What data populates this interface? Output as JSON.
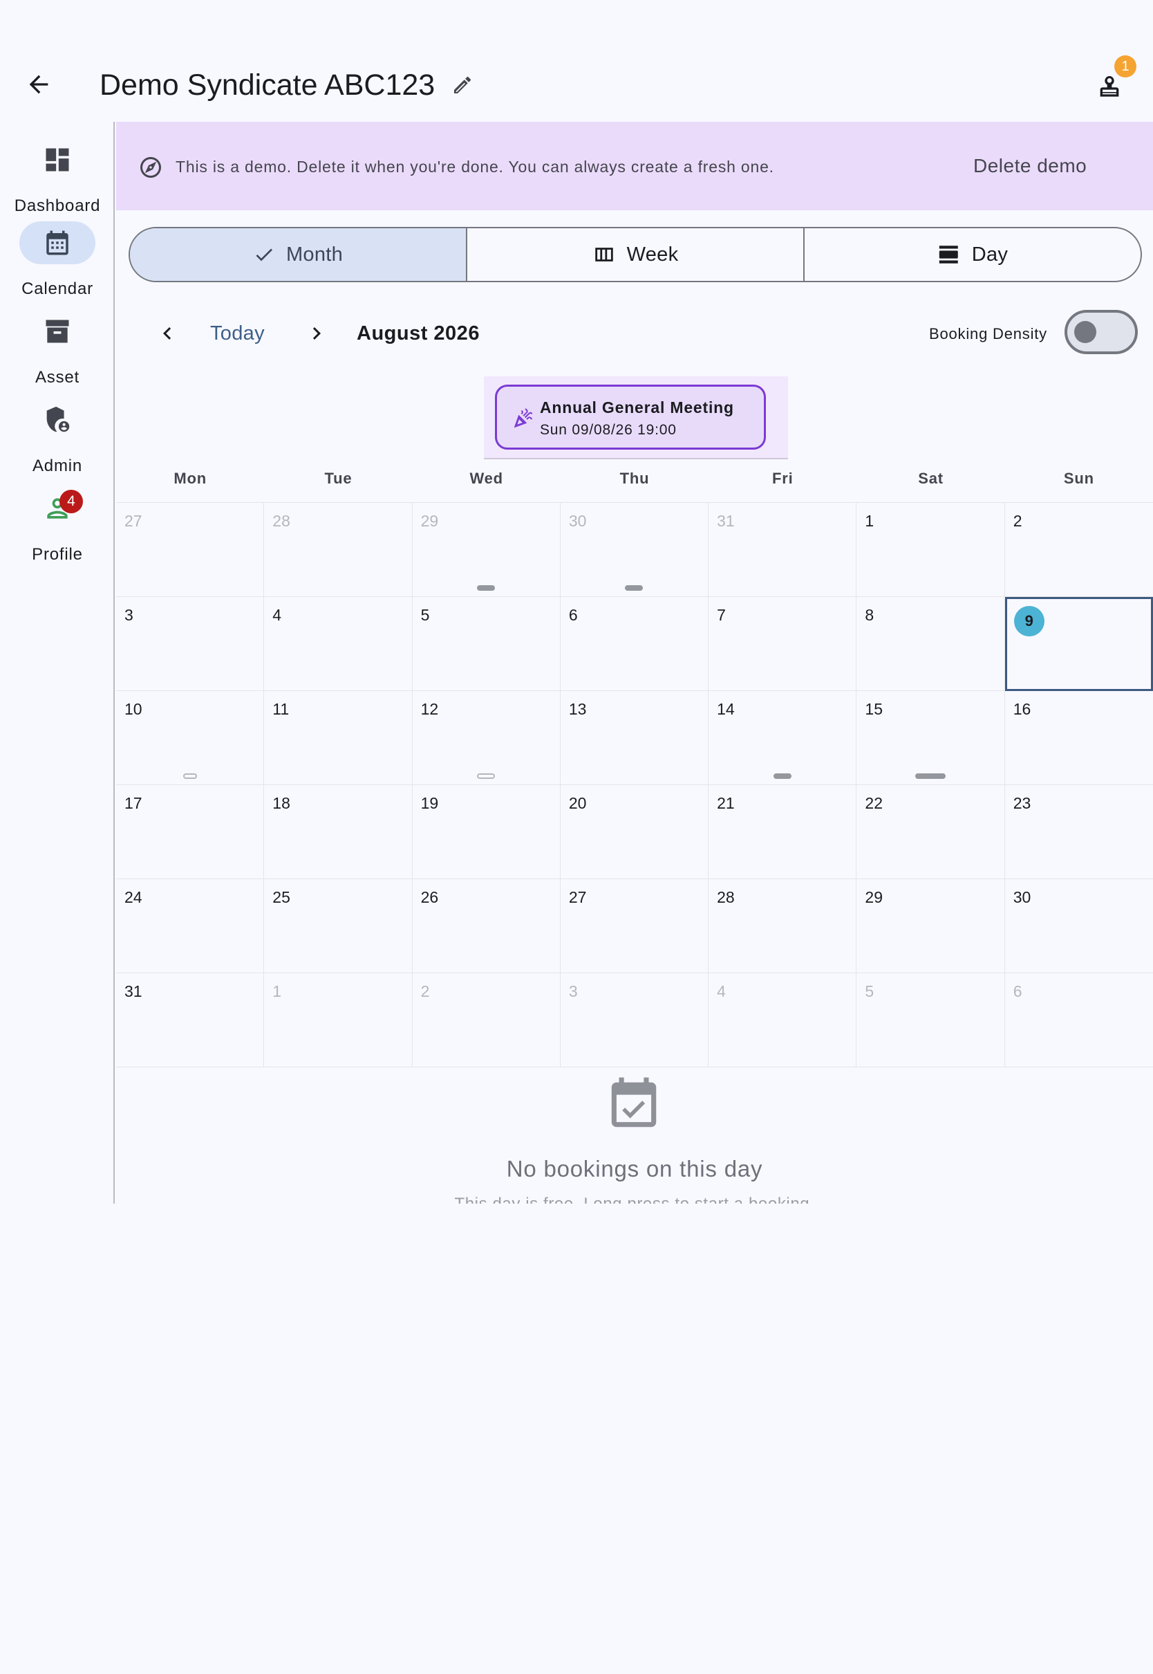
{
  "appbar": {
    "title": "Demo Syndicate ABC123",
    "user_badge_count": "1"
  },
  "nav": {
    "items": [
      {
        "label": "Dashboard",
        "icon": "dashboard-icon"
      },
      {
        "label": "Calendar",
        "icon": "calendar-icon",
        "active": true
      },
      {
        "label": "Asset",
        "icon": "archive-icon"
      },
      {
        "label": "Admin",
        "icon": "admin-shield-icon"
      },
      {
        "label": "Profile",
        "icon": "profile-icon",
        "badge": "4"
      }
    ]
  },
  "banner": {
    "text": "This is a demo. Delete it when you're done. You can always create a fresh one.",
    "action": "Delete demo"
  },
  "view_switcher": {
    "options": [
      "Month",
      "Week",
      "Day"
    ],
    "selected": "Month"
  },
  "month_nav": {
    "today_label": "Today",
    "month_label": "August 2026",
    "density_label": "Booking Density",
    "density_on": false
  },
  "event": {
    "title": "Annual General Meeting",
    "time": "Sun 09/08/26 19:00"
  },
  "calendar": {
    "weekdays": [
      "Mon",
      "Tue",
      "Wed",
      "Thu",
      "Fri",
      "Sat",
      "Sun"
    ],
    "weeks": [
      [
        "27",
        "28",
        "29",
        "30",
        "31",
        "1",
        "2"
      ],
      [
        "3",
        "4",
        "5",
        "6",
        "7",
        "8",
        "9"
      ],
      [
        "10",
        "11",
        "12",
        "13",
        "14",
        "15",
        "16"
      ],
      [
        "17",
        "18",
        "19",
        "20",
        "21",
        "22",
        "23"
      ],
      [
        "24",
        "25",
        "26",
        "27",
        "28",
        "29",
        "30"
      ],
      [
        "31",
        "1",
        "2",
        "3",
        "4",
        "5",
        "6"
      ]
    ],
    "selected_day": "9"
  },
  "empty_state": {
    "title": "No bookings on this day",
    "subtitle": "This day is free. Long press to start a booking."
  },
  "colors": {
    "accent": "#3d5a80",
    "today_dot": "#4cb3d4",
    "banner_bg": "#ebdbfa",
    "event_border": "#7b3bd4",
    "badge_red": "#ba1a1a",
    "badge_orange": "#f5a431"
  }
}
